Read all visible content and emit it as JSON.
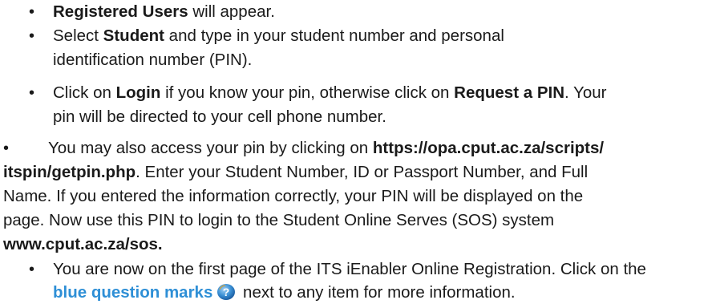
{
  "bullets": {
    "b1": {
      "bold": "Registered Users",
      "rest": " will appear."
    },
    "b2": {
      "pre": "Select ",
      "bold": "Student",
      "rest_line1": " and type in your student number and personal",
      "line2": "identification number (PIN)."
    },
    "b3": {
      "pre": "Click on ",
      "bold1": "Login",
      "mid": " if you know your pin, otherwise click on ",
      "bold2": "Request a PIN",
      "rest_line1": ". Your",
      "line2": "pin will be directed to your cell phone number."
    },
    "b4": {
      "pre": "You may also access your pin by clicking on ",
      "url_part1": "https://opa.cput.ac.za/scripts/",
      "url_part2": "itspin/getpin.php",
      "line2_rest": ". Enter your Student Number, ID or Passport Number, and Full",
      "line3": "Name. If you entered the information correctly, your PIN will be displayed on the",
      "line4": "page. Now use this PIN to login to the Student Online Serves (SOS) system",
      "line5": "www.cput.ac.za/sos."
    },
    "b5": {
      "line1": "You are now on the first page of the ITS iEnabler Online Registration. Click on the",
      "blue": "blue question marks",
      "rest": " next to any item for more information."
    }
  },
  "icons": {
    "question": "question-mark-icon"
  },
  "colors": {
    "text": "#1a1a1a",
    "link_blue": "#2e8fd6"
  }
}
